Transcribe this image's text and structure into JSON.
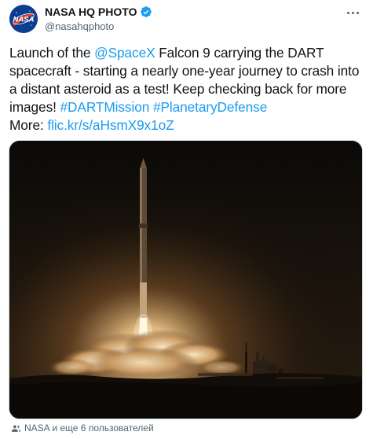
{
  "author": {
    "display_name": "NASA HQ PHOTO",
    "handle": "@nasahqphoto",
    "avatar_text": "NASA",
    "verified": true
  },
  "tweet": {
    "text_1": "Launch of the ",
    "mention": "@SpaceX",
    "text_2": " Falcon 9 carrying the DART spacecraft - starting a nearly one-year journey to crash into a distant asteroid as a test! Keep checking back for more images! ",
    "hashtag_1": "#DARTMission",
    "space": " ",
    "hashtag_2": "#PlanetaryDefense",
    "more_label": "More: ",
    "link": "flic.kr/s/aHsmX9x1oZ"
  },
  "footer": {
    "tagged_text": "NASA и еще 6 пользователей"
  },
  "colors": {
    "link": "#1d9bf0",
    "text": "#0f1419",
    "secondary": "#536471",
    "nasa_blue": "#0b3d91",
    "nasa_red": "#fc3d21"
  }
}
